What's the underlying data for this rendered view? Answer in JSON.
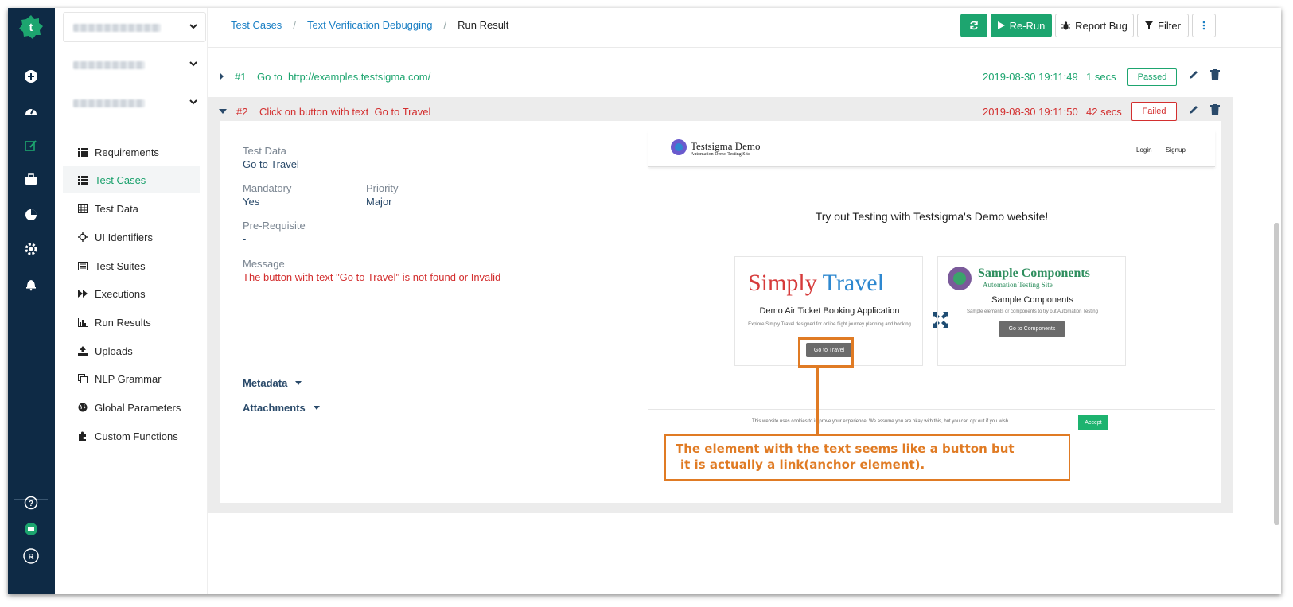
{
  "nav": {
    "items": [
      {
        "label": "Requirements",
        "icon": "list-icon"
      },
      {
        "label": "Test Cases",
        "icon": "list-icon"
      },
      {
        "label": "Test Data",
        "icon": "table-icon"
      },
      {
        "label": "UI Identifiers",
        "icon": "crosshair-icon"
      },
      {
        "label": "Test Suites",
        "icon": "suite-icon"
      },
      {
        "label": "Executions",
        "icon": "fast-forward-icon"
      },
      {
        "label": "Run Results",
        "icon": "bar-chart-icon"
      },
      {
        "label": "Uploads",
        "icon": "upload-icon"
      },
      {
        "label": "NLP Grammar",
        "icon": "copy-icon"
      },
      {
        "label": "Global Parameters",
        "icon": "globe-icon"
      },
      {
        "label": "Custom Functions",
        "icon": "puzzle-icon"
      }
    ],
    "active": "Test Cases"
  },
  "breadcrumb": {
    "first": "Test Cases",
    "second": "Text Verification Debugging",
    "current": "Run Result",
    "separator": "/"
  },
  "toolbar": {
    "rerun_label": "Re-Run",
    "report_bug_label": "Report Bug",
    "filter_label": "Filter"
  },
  "steps": [
    {
      "num": "#1",
      "action": "Go to",
      "target": "http://examples.testsigma.com/",
      "time": "2019-08-30 19:11:49",
      "duration": "1 secs",
      "status": "Passed"
    },
    {
      "num": "#2",
      "action": "Click on button with text",
      "target": "Go to Travel",
      "time": "2019-08-30 19:11:50",
      "duration": "42 secs",
      "status": "Failed"
    }
  ],
  "detail": {
    "test_data_label": "Test Data",
    "test_data_value": "Go to Travel",
    "mandatory_label": "Mandatory",
    "mandatory_value": "Yes",
    "priority_label": "Priority",
    "priority_value": "Major",
    "prereq_label": "Pre-Requisite",
    "prereq_value": "-",
    "message_label": "Message",
    "message_value": "The button with text \"Go to Travel\" is not found or Invalid",
    "metadata_label": "Metadata",
    "attachments_label": "Attachments"
  },
  "screenshot": {
    "brand": "Testsigma Demo",
    "brand_sub": "Automation Demo Testing Site",
    "login": "Login",
    "signup": "Signup",
    "heading": "Try out Testing with Testsigma's Demo website!",
    "card1_logo_a": "Simply",
    "card1_logo_b": "Travel",
    "card1_title": "Demo Air Ticket Booking Application",
    "card1_desc": "Explore Simply Travel designed for online flight journey planning and booking",
    "card1_button": "Go to Travel",
    "card2_logo": "Sample Components",
    "card2_logo_sub": "Automation Testing Site",
    "card2_title": "Sample Components",
    "card2_desc": "Sample elements or components to try out Automation Testing",
    "card2_button": "Go to Components",
    "cookie_text": "This website uses cookies to improve your experience. We assume you are okay with this, but you can opt out if you wish.",
    "cookie_accept": "Accept"
  },
  "annotation": {
    "line1": "The element with the text seems like a button but",
    "line2": "it is actually a link(anchor element)."
  },
  "colors": {
    "rail": "#0e2a45",
    "green": "#1da56f",
    "link": "#1a7fc4",
    "fail": "#d32f2f",
    "annotation": "#e07b24"
  }
}
